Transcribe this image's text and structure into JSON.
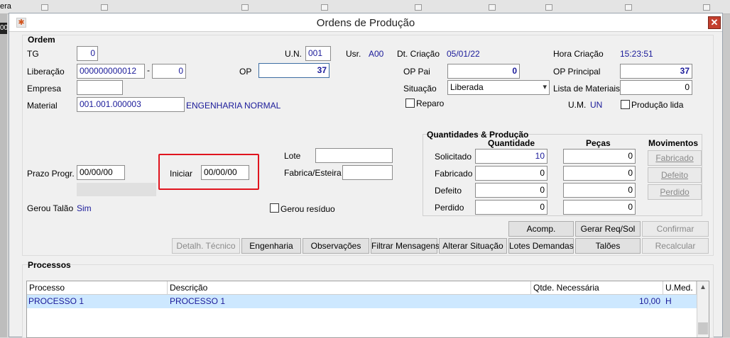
{
  "background": {
    "left_fragment": "00",
    "top_fragment": "era"
  },
  "window": {
    "title": "Ordens de Produção",
    "icon": "app-logo-icon",
    "close_icon": "close-icon"
  },
  "ordem": {
    "group_label": "Ordem",
    "tg_label": "TG",
    "tg_value": "0",
    "un_label": "U.N.",
    "un_value": "001",
    "usr_label": "Usr.",
    "usr_value": "A00",
    "dt_criacao_label": "Dt. Criação",
    "dt_criacao_value": "05/01/22",
    "hora_criacao_label": "Hora Criação",
    "hora_criacao_value": "15:23:51",
    "liberacao_label": "Liberação",
    "liberacao_value": "000000000012",
    "liberacao_sep": "-",
    "liberacao_seq": "0",
    "op_label": "OP",
    "op_value": "37",
    "op_pai_label": "OP Pai",
    "op_pai_value": "0",
    "op_principal_label": "OP Principal",
    "op_principal_value": "37",
    "empresa_label": "Empresa",
    "empresa_value": "",
    "situacao_label": "Situação",
    "situacao_value": "Liberada",
    "lista_materiais_label": "Lista de Materiais",
    "lista_materiais_value": "0",
    "material_label": "Material",
    "material_code": "001.001.000003",
    "material_desc": "ENGENHARIA NORMAL",
    "reparo_label": "Reparo",
    "um_label": "U.M.",
    "um_value": "UN",
    "producao_lida_label": "Produção lida",
    "lote_label": "Lote",
    "lote_value": "",
    "fabrica_label": "Fabrica/Esteira",
    "fabrica_value": "",
    "prazo_label": "Prazo Progr.",
    "prazo_value": "00/00/00",
    "iniciar_label": "Iniciar",
    "iniciar_value": "00/00/00",
    "gerou_talao_label": "Gerou Talão",
    "gerou_talao_value": "Sim",
    "gerou_residuo_label": "Gerou resíduo"
  },
  "quantidades": {
    "group_label": "Quantidades & Produção",
    "col_quantidade": "Quantidade",
    "col_pecas": "Peças",
    "col_movimentos": "Movimentos",
    "rows": [
      {
        "label": "Solicitado",
        "quantidade": "10",
        "pecas": "0",
        "movimento": "Fabricado"
      },
      {
        "label": "Fabricado",
        "quantidade": "0",
        "pecas": "0",
        "movimento": "Defeito"
      },
      {
        "label": "Defeito",
        "quantidade": "0",
        "pecas": "0",
        "movimento": "Perdido"
      },
      {
        "label": "Perdido",
        "quantidade": "0",
        "pecas": "0",
        "movimento": ""
      }
    ]
  },
  "buttons": {
    "acomp": "Acomp.",
    "gerar_req": "Gerar Req/Sol",
    "confirmar": "Confirmar",
    "detalh_tecnico": "Detalh. Técnico",
    "engenharia": "Engenharia",
    "observacoes": "Observações",
    "filtrar_mensagens": "Filtrar Mensagens",
    "alterar_situacao": "Alterar Situação",
    "lotes_demandas": "Lotes Demandas",
    "taloes": "Talões",
    "recalcular": "Recalcular"
  },
  "processos": {
    "group_label": "Processos",
    "columns": [
      "Processo",
      "Descrição",
      "Qtde. Necessária",
      "U.Med."
    ],
    "rows": [
      {
        "processo": "PROCESSO 1",
        "descricao": "PROCESSO 1",
        "qtde": "10,00",
        "umed": "H"
      }
    ]
  }
}
